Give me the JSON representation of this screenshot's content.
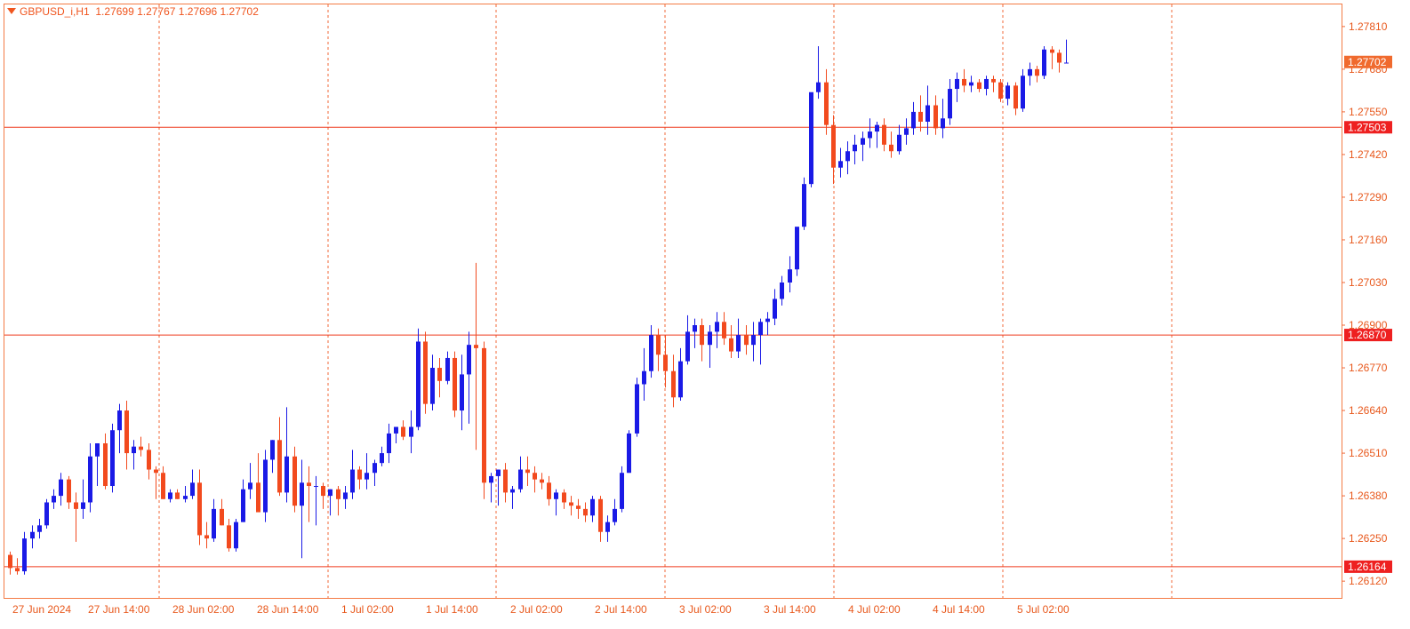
{
  "header": {
    "symbol": "GBPUSD_i,H1",
    "ohlc": "1.27699 1.27767 1.27696 1.27702"
  },
  "colors": {
    "bull": "#1a1ae6",
    "bear": "#f24a1e",
    "grid": "#f06a3a",
    "hline": "#ef3a1e",
    "axis_text": "#e8581c",
    "label_bg_price": "#f06a2e",
    "label_bg_line": "#ee2020"
  },
  "chart_data": {
    "type": "candlestick",
    "title": "GBPUSD_i,H1",
    "ylim": [
      1.2605,
      1.2788
    ],
    "y_ticks": [
      "1.27810",
      "1.27680",
      "1.27550",
      "1.27420",
      "1.27290",
      "1.27160",
      "1.27030",
      "1.26900",
      "1.26770",
      "1.26640",
      "1.26510",
      "1.26380",
      "1.26250",
      "1.26120"
    ],
    "x_labels": [
      "27 Jun 2024",
      "27 Jun 14:00",
      "28 Jun 02:00",
      "28 Jun 14:00",
      "1 Jul 02:00",
      "1 Jul 14:00",
      "2 Jul 02:00",
      "2 Jul 14:00",
      "3 Jul 02:00",
      "3 Jul 14:00",
      "4 Jul 02:00",
      "4 Jul 14:00",
      "5 Jul 02:00"
    ],
    "horizontal_lines": [
      {
        "price": "1.27503",
        "value": 1.27503
      },
      {
        "price": "1.26870",
        "value": 1.2687
      },
      {
        "price": "1.26164",
        "value": 1.26164
      }
    ],
    "current_price": {
      "price": "1.27702",
      "value": 1.27702
    },
    "candles": [
      [
        1.262,
        1.2621,
        1.2614,
        1.2616
      ],
      [
        1.2616,
        1.2619,
        1.2614,
        1.2615
      ],
      [
        1.2615,
        1.2627,
        1.2614,
        1.2625
      ],
      [
        1.2625,
        1.2629,
        1.2622,
        1.2627
      ],
      [
        1.2627,
        1.2631,
        1.2625,
        1.2629
      ],
      [
        1.2629,
        1.2637,
        1.2628,
        1.2636
      ],
      [
        1.2636,
        1.264,
        1.2634,
        1.2638
      ],
      [
        1.2638,
        1.2645,
        1.2635,
        1.2643
      ],
      [
        1.2643,
        1.2644,
        1.2634,
        1.2636
      ],
      [
        1.2636,
        1.2639,
        1.2624,
        1.2634
      ],
      [
        1.2634,
        1.2643,
        1.2631,
        1.2636
      ],
      [
        1.2636,
        1.2654,
        1.2633,
        1.265
      ],
      [
        1.265,
        1.2654,
        1.2641,
        1.2654
      ],
      [
        1.2654,
        1.2657,
        1.264,
        1.2641
      ],
      [
        1.2641,
        1.266,
        1.2639,
        1.2658
      ],
      [
        1.2658,
        1.2666,
        1.2651,
        1.2664
      ],
      [
        1.2664,
        1.2667,
        1.2646,
        1.2651
      ],
      [
        1.2651,
        1.2655,
        1.2646,
        1.2653
      ],
      [
        1.2653,
        1.2656,
        1.265,
        1.2652
      ],
      [
        1.2652,
        1.2654,
        1.2643,
        1.2646
      ],
      [
        1.2646,
        1.2647,
        1.2637,
        1.2645
      ],
      [
        1.2645,
        1.2647,
        1.2637,
        1.2637
      ],
      [
        1.2637,
        1.264,
        1.2636,
        1.2639
      ],
      [
        1.2639,
        1.264,
        1.2637,
        1.2637
      ],
      [
        1.2637,
        1.2641,
        1.2636,
        1.2638
      ],
      [
        1.2638,
        1.2646,
        1.2637,
        1.2642
      ],
      [
        1.2642,
        1.2646,
        1.2623,
        1.2626
      ],
      [
        1.2626,
        1.263,
        1.2622,
        1.2625
      ],
      [
        1.2625,
        1.2637,
        1.2624,
        1.2634
      ],
      [
        1.2634,
        1.2637,
        1.2629,
        1.2629
      ],
      [
        1.2629,
        1.2631,
        1.2621,
        1.2622
      ],
      [
        1.2622,
        1.2631,
        1.2621,
        1.263
      ],
      [
        1.263,
        1.2643,
        1.263,
        1.264
      ],
      [
        1.264,
        1.2648,
        1.2637,
        1.2642
      ],
      [
        1.2642,
        1.2651,
        1.2639,
        1.2633
      ],
      [
        1.2633,
        1.2652,
        1.263,
        1.2649
      ],
      [
        1.2649,
        1.2655,
        1.2645,
        1.2655
      ],
      [
        1.2655,
        1.2662,
        1.2638,
        1.2639
      ],
      [
        1.2639,
        1.2665,
        1.2636,
        1.265
      ],
      [
        1.265,
        1.2653,
        1.2633,
        1.2635
      ],
      [
        1.2635,
        1.2649,
        1.2619,
        1.2642
      ],
      [
        1.2642,
        1.2647,
        1.263,
        1.2641
      ],
      [
        1.2641,
        1.2644,
        1.2629,
        1.2641
      ],
      [
        1.2641,
        1.2642,
        1.2634,
        1.2638
      ],
      [
        1.2638,
        1.264,
        1.2632,
        1.264
      ],
      [
        1.264,
        1.2641,
        1.2632,
        1.2637
      ],
      [
        1.2637,
        1.2641,
        1.2634,
        1.2639
      ],
      [
        1.2639,
        1.2652,
        1.2637,
        1.2646
      ],
      [
        1.2646,
        1.2647,
        1.264,
        1.2643
      ],
      [
        1.2643,
        1.2651,
        1.264,
        1.2645
      ],
      [
        1.2645,
        1.2649,
        1.2641,
        1.2648
      ],
      [
        1.2648,
        1.2653,
        1.2647,
        1.2651
      ],
      [
        1.2651,
        1.266,
        1.2648,
        1.2657
      ],
      [
        1.2657,
        1.2659,
        1.2654,
        1.2659
      ],
      [
        1.2659,
        1.2661,
        1.2655,
        1.2656
      ],
      [
        1.2656,
        1.2664,
        1.2651,
        1.2659
      ],
      [
        1.2659,
        1.2689,
        1.2658,
        1.2685
      ],
      [
        1.2685,
        1.2688,
        1.2663,
        1.2666
      ],
      [
        1.2666,
        1.2681,
        1.2664,
        1.2677
      ],
      [
        1.2677,
        1.268,
        1.2668,
        1.2673
      ],
      [
        1.2673,
        1.2682,
        1.2672,
        1.268
      ],
      [
        1.268,
        1.2682,
        1.2662,
        1.2664
      ],
      [
        1.2664,
        1.2681,
        1.2658,
        1.2675
      ],
      [
        1.2675,
        1.2688,
        1.266,
        1.2684
      ],
      [
        1.2684,
        1.2709,
        1.2652,
        1.2683
      ],
      [
        1.2683,
        1.2685,
        1.2637,
        1.2642
      ],
      [
        1.2642,
        1.2645,
        1.2636,
        1.2644
      ],
      [
        1.2644,
        1.2646,
        1.2635,
        1.2646
      ],
      [
        1.2646,
        1.2648,
        1.2636,
        1.2639
      ],
      [
        1.2639,
        1.2641,
        1.2634,
        1.264
      ],
      [
        1.264,
        1.265,
        1.2639,
        1.2646
      ],
      [
        1.2646,
        1.265,
        1.2641,
        1.2645
      ],
      [
        1.2645,
        1.2647,
        1.2639,
        1.2643
      ],
      [
        1.2643,
        1.2645,
        1.264,
        1.2642
      ],
      [
        1.2642,
        1.2644,
        1.2635,
        1.2637
      ],
      [
        1.2637,
        1.264,
        1.2632,
        1.2639
      ],
      [
        1.2639,
        1.264,
        1.2634,
        1.2636
      ],
      [
        1.2636,
        1.2638,
        1.2632,
        1.2635
      ],
      [
        1.2635,
        1.2637,
        1.2631,
        1.2634
      ],
      [
        1.2634,
        1.2636,
        1.263,
        1.2632
      ],
      [
        1.2632,
        1.2638,
        1.263,
        1.2637
      ],
      [
        1.2637,
        1.2638,
        1.2624,
        1.2627
      ],
      [
        1.2627,
        1.2632,
        1.2624,
        1.263
      ],
      [
        1.263,
        1.2637,
        1.2629,
        1.2634
      ],
      [
        1.2634,
        1.2647,
        1.2633,
        1.2645
      ],
      [
        1.2645,
        1.2658,
        1.2645,
        1.2657
      ],
      [
        1.2657,
        1.2674,
        1.2656,
        1.2672
      ],
      [
        1.2672,
        1.2683,
        1.2667,
        1.2676
      ],
      [
        1.2676,
        1.269,
        1.2674,
        1.2687
      ],
      [
        1.2687,
        1.2689,
        1.2676,
        1.2681
      ],
      [
        1.2681,
        1.2687,
        1.2671,
        1.2676
      ],
      [
        1.2676,
        1.2681,
        1.2665,
        1.2668
      ],
      [
        1.2668,
        1.2683,
        1.2667,
        1.2679
      ],
      [
        1.2679,
        1.2693,
        1.2678,
        1.2688
      ],
      [
        1.2688,
        1.2692,
        1.2683,
        1.269
      ],
      [
        1.269,
        1.2692,
        1.2679,
        1.2684
      ],
      [
        1.2684,
        1.269,
        1.2677,
        1.2688
      ],
      [
        1.2688,
        1.2694,
        1.2683,
        1.2691
      ],
      [
        1.2691,
        1.2694,
        1.2684,
        1.2686
      ],
      [
        1.2686,
        1.269,
        1.268,
        1.2682
      ],
      [
        1.2682,
        1.2692,
        1.268,
        1.2687
      ],
      [
        1.2687,
        1.269,
        1.2681,
        1.2684
      ],
      [
        1.2684,
        1.2691,
        1.2679,
        1.2687
      ],
      [
        1.2687,
        1.2692,
        1.2678,
        1.2691
      ],
      [
        1.2691,
        1.2694,
        1.2687,
        1.2692
      ],
      [
        1.2692,
        1.2701,
        1.269,
        1.2698
      ],
      [
        1.2698,
        1.2705,
        1.2696,
        1.2703
      ],
      [
        1.2703,
        1.2711,
        1.27,
        1.2707
      ],
      [
        1.2707,
        1.2719,
        1.2705,
        1.272
      ],
      [
        1.272,
        1.2735,
        1.2719,
        1.2733
      ],
      [
        1.2733,
        1.2755,
        1.2732,
        1.2761
      ],
      [
        1.2761,
        1.2775,
        1.2759,
        1.2764
      ],
      [
        1.2764,
        1.2768,
        1.2748,
        1.2751
      ],
      [
        1.2751,
        1.2754,
        1.2733,
        1.2738
      ],
      [
        1.2738,
        1.2744,
        1.2735,
        1.274
      ],
      [
        1.274,
        1.2746,
        1.2736,
        1.2743
      ],
      [
        1.2743,
        1.2748,
        1.2739,
        1.2745
      ],
      [
        1.2745,
        1.2749,
        1.274,
        1.2747
      ],
      [
        1.2747,
        1.2753,
        1.2744,
        1.2749
      ],
      [
        1.2749,
        1.2752,
        1.2744,
        1.2751
      ],
      [
        1.2751,
        1.2753,
        1.2743,
        1.2745
      ],
      [
        1.2745,
        1.2749,
        1.2741,
        1.2743
      ],
      [
        1.2743,
        1.2751,
        1.2742,
        1.2748
      ],
      [
        1.2748,
        1.2753,
        1.2745,
        1.275
      ],
      [
        1.275,
        1.2758,
        1.2748,
        1.2755
      ],
      [
        1.2755,
        1.276,
        1.2749,
        1.2752
      ],
      [
        1.2752,
        1.2763,
        1.2748,
        1.2757
      ],
      [
        1.2757,
        1.276,
        1.2748,
        1.275
      ],
      [
        1.275,
        1.2759,
        1.2747,
        1.2753
      ],
      [
        1.2753,
        1.2765,
        1.2751,
        1.2762
      ],
      [
        1.2762,
        1.2767,
        1.2758,
        1.2765
      ],
      [
        1.2765,
        1.2768,
        1.2761,
        1.2763
      ],
      [
        1.2763,
        1.2766,
        1.2761,
        1.2764
      ],
      [
        1.2764,
        1.2765,
        1.2761,
        1.2762
      ],
      [
        1.2762,
        1.2766,
        1.276,
        1.2765
      ],
      [
        1.2765,
        1.2766,
        1.2761,
        1.2764
      ],
      [
        1.2764,
        1.2765,
        1.2758,
        1.2759
      ],
      [
        1.2759,
        1.2764,
        1.2757,
        1.2763
      ],
      [
        1.2763,
        1.2764,
        1.2754,
        1.2756
      ],
      [
        1.2756,
        1.2768,
        1.2755,
        1.2766
      ],
      [
        1.2766,
        1.277,
        1.2763,
        1.2768
      ],
      [
        1.2768,
        1.2769,
        1.2764,
        1.2766
      ],
      [
        1.2766,
        1.2775,
        1.2765,
        1.2774
      ],
      [
        1.2774,
        1.2775,
        1.2768,
        1.2773
      ],
      [
        1.2773,
        1.2774,
        1.2767,
        1.277
      ],
      [
        1.277,
        1.2777,
        1.277,
        1.277
      ]
    ]
  }
}
